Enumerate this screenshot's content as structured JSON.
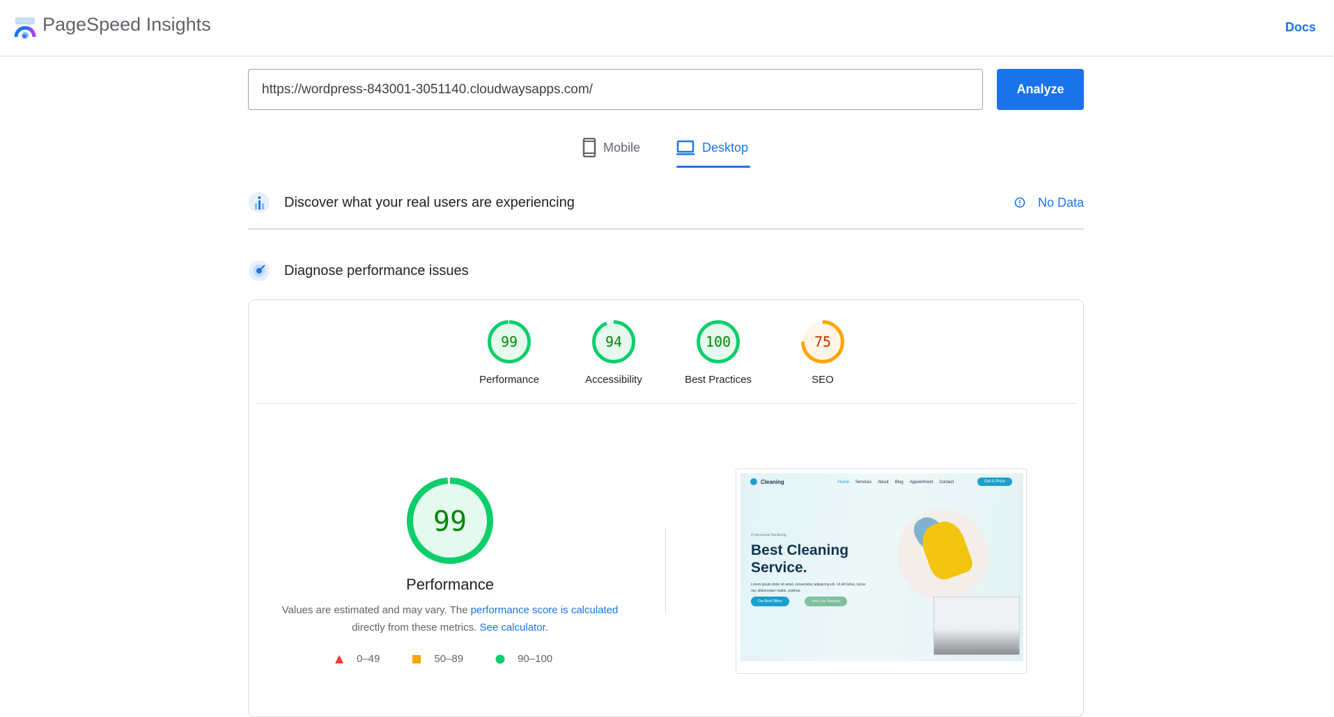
{
  "header": {
    "title": "PageSpeed Insights",
    "docs_label": "Docs"
  },
  "search": {
    "url_value": "https://wordpress-843001-3051140.cloudwaysapps.com/",
    "analyze_label": "Analyze"
  },
  "tabs": [
    {
      "label": "Mobile",
      "icon": "phone-icon",
      "active": false
    },
    {
      "label": "Desktop",
      "icon": "laptop-icon",
      "active": true
    }
  ],
  "field_data": {
    "title": "Discover what your real users are experiencing",
    "status": "No Data"
  },
  "lab_data": {
    "title": "Diagnose performance issues"
  },
  "categories": [
    {
      "label": "Performance",
      "score": 99,
      "rating": "pass"
    },
    {
      "label": "Accessibility",
      "score": 94,
      "rating": "pass"
    },
    {
      "label": "Best Practices",
      "score": 100,
      "rating": "pass"
    },
    {
      "label": "SEO",
      "score": 75,
      "rating": "average"
    }
  ],
  "performance": {
    "score": 99,
    "label": "Performance",
    "desc_prefix": "Values are estimated and may vary. The ",
    "desc_link1": "performance score is calculated",
    "desc_middle": " directly from these metrics. ",
    "desc_link2": "See calculator."
  },
  "legend": [
    {
      "range": "0–49",
      "shape": "triangle",
      "color": "#ff3333"
    },
    {
      "range": "50–89",
      "shape": "square",
      "color": "#ffa400"
    },
    {
      "range": "90–100",
      "shape": "circle",
      "color": "#0cce6b"
    }
  ],
  "colors": {
    "accent": "#1a73e8",
    "pass": "#0cce6b",
    "pass_text": "#008800",
    "pass_fill": "#e5f9ee",
    "average": "#ffa400",
    "average_text": "#c33300",
    "average_fill": "#fff4e6"
  },
  "thumbnail": {
    "brand": "Cleaning",
    "nav": [
      "Home",
      "Services",
      "About",
      "Blog",
      "Appointment",
      "Contact"
    ],
    "cta": "Get A Price",
    "eyebrow": "Professional Sanitizing",
    "headline": "Best Cleaning Service.",
    "body": "Lorem ipsum dolor sit amet, consectetur adipiscing elit. Ut elit tellus, luctus nec ullamcorper mattis, pulvinar.",
    "btn1": "Our Best Offers",
    "btn2": "View Our Services"
  }
}
